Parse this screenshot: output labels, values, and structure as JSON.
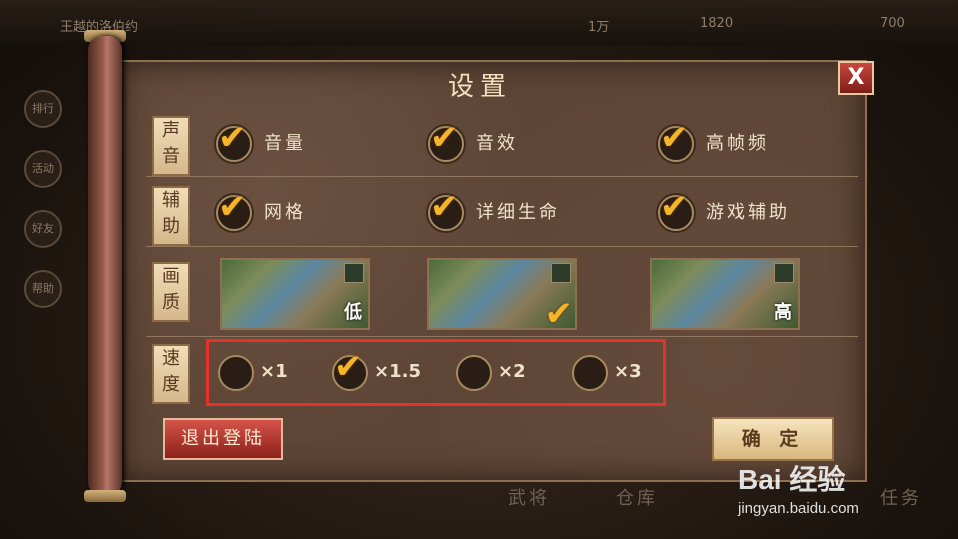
{
  "background": {
    "player_name": "王越的洛伯约",
    "resources": [
      "1万",
      "1820",
      "700"
    ],
    "side_menu": [
      "排行",
      "活动",
      "好友",
      "帮助"
    ],
    "bottom_nav": [
      "武将",
      "仓库",
      "任务"
    ]
  },
  "dialog": {
    "title": "设置",
    "close_label": "X",
    "sections": {
      "sound": {
        "tag": "声音",
        "options": [
          {
            "label": "音量",
            "checked": true
          },
          {
            "label": "音效",
            "checked": true
          },
          {
            "label": "高帧频",
            "checked": true
          }
        ]
      },
      "assist": {
        "tag": "辅助",
        "options": [
          {
            "label": "网格",
            "checked": true
          },
          {
            "label": "详细生命",
            "checked": true
          },
          {
            "label": "游戏辅助",
            "checked": true
          }
        ]
      },
      "quality": {
        "tag": "画质",
        "options": [
          {
            "label": "低",
            "selected": false
          },
          {
            "label": "",
            "selected": true
          },
          {
            "label": "高",
            "selected": false
          }
        ]
      },
      "speed": {
        "tag": "速度",
        "options": [
          {
            "label": "×1",
            "selected": false
          },
          {
            "label": "×1.5",
            "selected": true
          },
          {
            "label": "×2",
            "selected": false
          },
          {
            "label": "×3",
            "selected": false
          }
        ],
        "highlight_color": "#e8302c"
      }
    },
    "logout_label": "退出登陆",
    "confirm_label": "确 定"
  },
  "watermark": {
    "logo": "Bai 经验",
    "url": "jingyan.baidu.com"
  },
  "colors": {
    "check": "#f4b52a",
    "panel": "#5d4536"
  }
}
